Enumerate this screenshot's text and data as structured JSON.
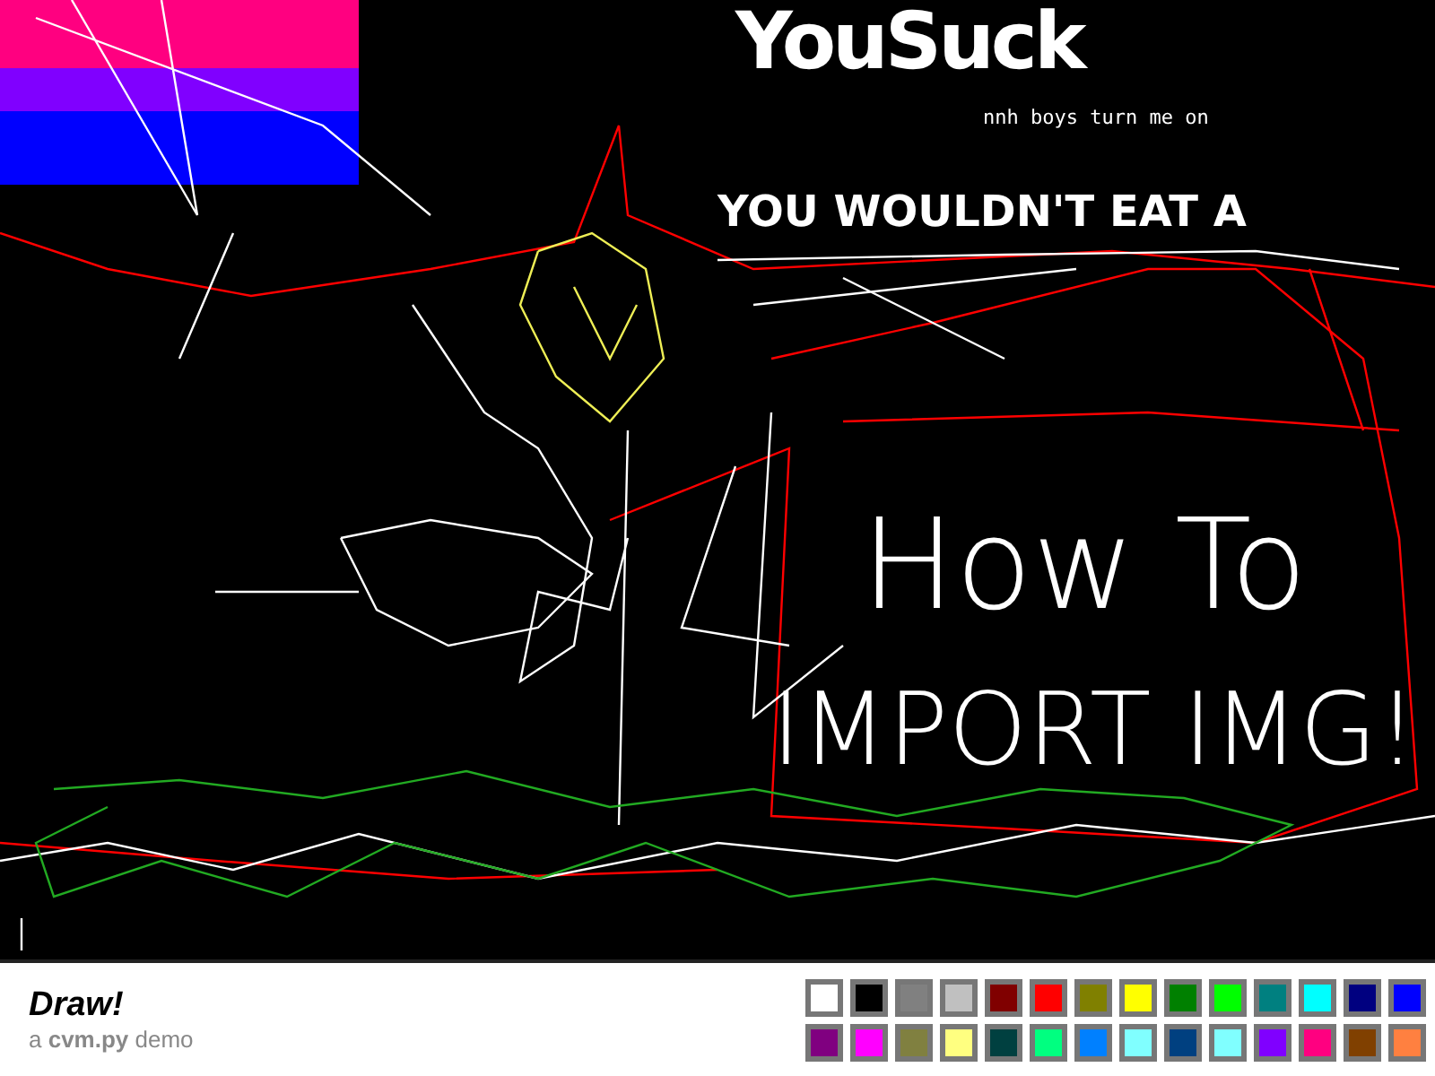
{
  "canvas": {
    "texts": [
      {
        "kind": "headline",
        "text": "YouSuck"
      },
      {
        "kind": "small",
        "text": "nnh boys turn me on"
      },
      {
        "kind": "stencil",
        "text": "YOU WOULDN'T EAT A"
      },
      {
        "kind": "handwriting",
        "text": "How To"
      },
      {
        "kind": "handwriting-large",
        "text": "IMPORT IMG!"
      }
    ]
  },
  "footer": {
    "title": "Draw!",
    "subtitle": "a **cvm.py** demo"
  },
  "palette": {
    "rows": [
      [
        {
          "color": "#ffffff"
        },
        {
          "color": "#000000"
        },
        {
          "color": "#808080"
        },
        {
          "color": "#c0c0c0"
        },
        {
          "color": "#800000"
        },
        {
          "color": "#ff0000"
        },
        {
          "color": "#808000"
        },
        {
          "color": "#ffff00"
        },
        {
          "color": "#008000"
        },
        {
          "color": "#00ff00"
        },
        {
          "color": "#008080"
        },
        {
          "color": "#00ffff"
        },
        {
          "color": "#000080"
        },
        {
          "color": "#0000ff"
        }
      ],
      [
        {
          "color": "#800080"
        },
        {
          "color": "#ff00ff"
        },
        {
          "color": "#808040"
        },
        {
          "color": "#ffff80"
        },
        {
          "color": "#004040"
        },
        {
          "color": "#00ff80"
        },
        {
          "color": "#0080ff"
        },
        {
          "color": "#80ffff"
        },
        {
          "color": "#004080"
        },
        {
          "color": "#80ffff"
        },
        {
          "color": "#8000ff"
        },
        {
          "color": "#ff0080"
        },
        {
          "color": "#804000"
        },
        {
          "color": "#ff8040"
        }
      ]
    ]
  }
}
